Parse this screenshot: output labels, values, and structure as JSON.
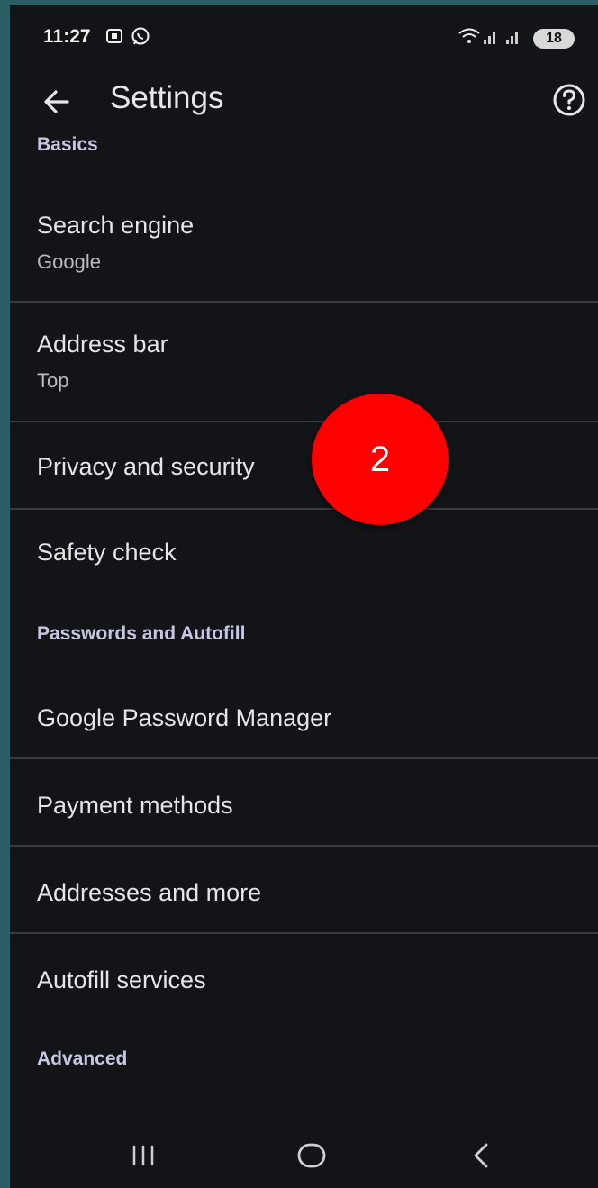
{
  "status_bar": {
    "time": "11:27",
    "battery": "18",
    "icons": [
      "screenshot-icon",
      "whatsapp-icon",
      "wifi-icon",
      "signal-icon",
      "signal-icon",
      "battery-icon"
    ]
  },
  "app_bar": {
    "title": "Settings",
    "back_icon": "arrow-left-icon",
    "help_icon": "help-circle-icon"
  },
  "sections": {
    "basics": "Basics",
    "passwords": "Passwords and Autofill",
    "advanced": "Advanced"
  },
  "items": {
    "search_engine": {
      "title": "Search engine",
      "subtitle": "Google"
    },
    "address_bar": {
      "title": "Address bar",
      "subtitle": "Top"
    },
    "privacy": {
      "title": "Privacy and security"
    },
    "safety": {
      "title": "Safety check"
    },
    "password_manager": {
      "title": "Google Password Manager"
    },
    "payment": {
      "title": "Payment methods"
    },
    "addresses": {
      "title": "Addresses and more"
    },
    "autofill": {
      "title": "Autofill services"
    }
  },
  "annotation": {
    "label": "2",
    "color": "#ff0000"
  },
  "colors": {
    "background": "#131418",
    "outer": "#2c5f63",
    "section_header": "#c6c8e2"
  },
  "nav_bar": [
    "recents-icon",
    "home-icon",
    "back-icon"
  ]
}
